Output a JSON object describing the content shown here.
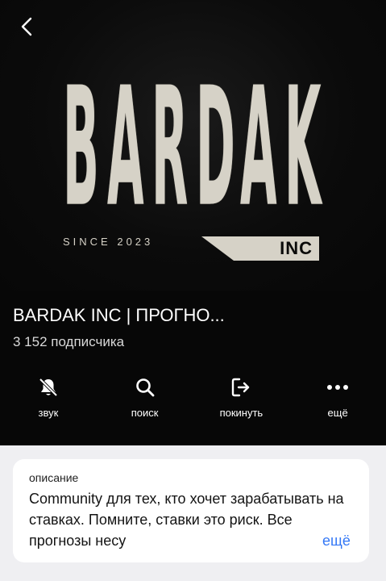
{
  "cover": {
    "logo_letters": [
      "B",
      "A",
      "R",
      "D",
      "A",
      "K"
    ],
    "since_text": "SINCE 2023",
    "inc_text": "INC"
  },
  "channel": {
    "name": "BARDAK INC | ПРОГНО...",
    "subscribers": "3 152 подписчика"
  },
  "actions": [
    {
      "label": "звук",
      "icon": "bell-slash-icon"
    },
    {
      "label": "поиск",
      "icon": "search-icon"
    },
    {
      "label": "покинуть",
      "icon": "leave-icon"
    },
    {
      "label": "ещё",
      "icon": "more-dots-icon"
    }
  ],
  "description": {
    "label": "описание",
    "text": "Community для тех, кто хочет зарабатывать на ставках. Помните, ставки это риск. Все прогнозы несу",
    "more": "ещё"
  },
  "colors": {
    "background": "#070707",
    "logo": "#d6d2c7",
    "link": "#3478f6",
    "sheet": "#efeff2"
  }
}
